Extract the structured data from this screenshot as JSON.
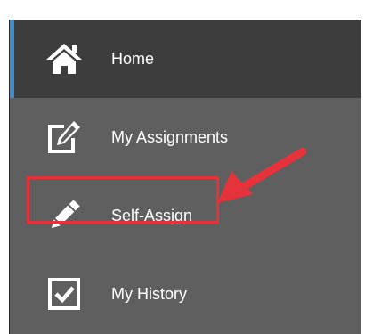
{
  "nav": {
    "items": [
      {
        "label": "Home",
        "icon": "home-icon",
        "active": true
      },
      {
        "label": "My Assignments",
        "icon": "edit-square-icon",
        "active": false
      },
      {
        "label": "Self-Assign",
        "icon": "pencil-icon",
        "active": false
      },
      {
        "label": "My History",
        "icon": "checkbox-icon",
        "active": false
      }
    ]
  },
  "annotation": {
    "highlight_color": "#e5323b",
    "arrow_color": "#e5323b"
  },
  "colors": {
    "sidebar_bg": "#5f5f5f",
    "active_bg": "#3d3d3d",
    "active_accent": "#3a8ed0",
    "text": "#ffffff"
  }
}
